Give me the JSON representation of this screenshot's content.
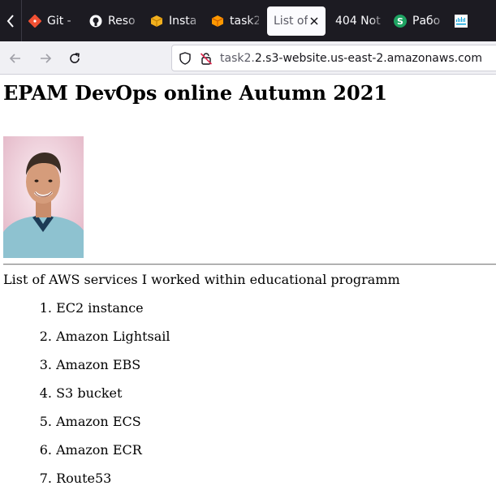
{
  "browser": {
    "tabs": [
      {
        "label": "Git -",
        "icon": "git-icon"
      },
      {
        "label": "Reso",
        "icon": "github-icon"
      },
      {
        "label": "Insta",
        "icon": "box-icon"
      },
      {
        "label": "task2",
        "icon": "aws-cube-icon"
      },
      {
        "label": "List of",
        "icon": "none",
        "active": true
      },
      {
        "label": "404 Not",
        "icon": "none"
      },
      {
        "label": "Рабо",
        "icon": "s-circle-icon"
      },
      {
        "label": "",
        "icon": "cisco-icon"
      }
    ],
    "url": {
      "scheme": "task2.",
      "host": "2.s3-website.us-east-2.amazonaws.com"
    }
  },
  "page": {
    "heading": "EPAM DevOps online Autumn 2021",
    "intro": "List of AWS services I worked within educational programm",
    "services": [
      {
        "n": "1.",
        "name": "EC2 instance"
      },
      {
        "n": "2.",
        "name": "Amazon Lightsail"
      },
      {
        "n": "3.",
        "name": "Amazon EBS"
      },
      {
        "n": "4.",
        "name": "S3 bucket"
      },
      {
        "n": "5.",
        "name": "Amazon ECS"
      },
      {
        "n": "6.",
        "name": "Amazon ECR"
      },
      {
        "n": "7.",
        "name": "Route53"
      }
    ]
  },
  "colors": {
    "tabstrip": "#1c1b22",
    "active_tab": "#fbfbfe",
    "git": "#f05033",
    "aws": "#ff9900",
    "green": "#1ea362"
  }
}
